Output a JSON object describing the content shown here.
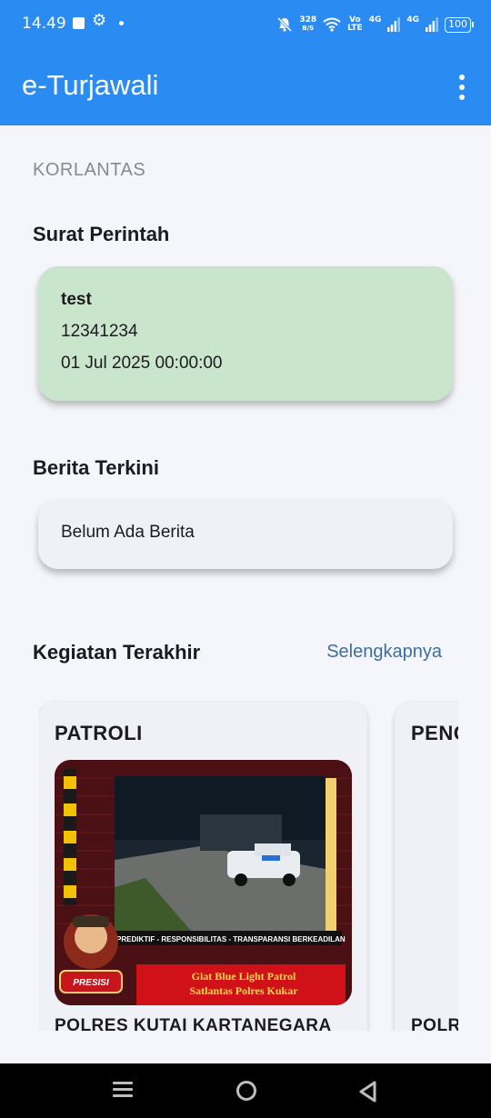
{
  "status_bar": {
    "time": "14.49",
    "speed_value": "328",
    "speed_unit": "B/S",
    "volte_top": "Vo",
    "volte_bottom": "LTE",
    "network_1": "4G",
    "network_2": "4G",
    "battery": "100",
    "icons": [
      "notification-square-icon",
      "settings-gear-icon",
      "dot-icon",
      "mute-bell-icon",
      "wifi-icon",
      "signal-icon",
      "battery-icon"
    ]
  },
  "app_bar": {
    "title": "e-Turjawali",
    "menu_icon": "more-vert-icon"
  },
  "organization": "KORLANTAS",
  "surat_perintah": {
    "section_title": "Surat Perintah",
    "card": {
      "name": "test",
      "number": "12341234",
      "date": "01 Jul 2025 00:00:00",
      "background": "#c9e5cc"
    }
  },
  "berita": {
    "section_title": "Berita Terkini",
    "empty_text": "Belum Ada Berita"
  },
  "kegiatan": {
    "section_title": "Kegiatan Terakhir",
    "more_link": "Selengkapnya",
    "cards": [
      {
        "category": "PATROLI",
        "unit": "POLRES KUTAI KARTANEGARA",
        "image": {
          "tagline": "PREDIKTIF - RESPONSIBILITAS - TRANSPARANSI BERKEADILAN",
          "line1": "Giat Blue Light Patrol",
          "line2": "Satlantas Polres Kukar",
          "badge": "PRESISI"
        }
      },
      {
        "category": "PENGATURAN",
        "unit": "POLRES"
      }
    ]
  },
  "colors": {
    "primary": "#2a8bf2",
    "link": "#3a6ea5",
    "background": "#f5f6fb"
  },
  "nav_bar": {
    "icons": [
      "recent-apps-icon",
      "home-icon",
      "back-icon"
    ]
  }
}
